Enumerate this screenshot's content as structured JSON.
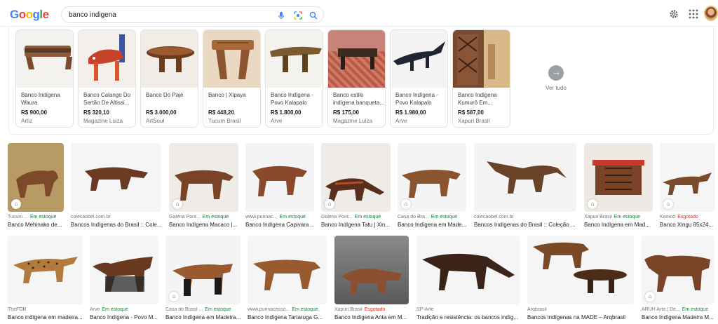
{
  "header": {
    "logo": [
      "G",
      "o",
      "o",
      "g",
      "l",
      "e"
    ],
    "logo_colors": [
      "#4285f4",
      "#ea4335",
      "#fbbc05",
      "#4285f4",
      "#34a853",
      "#ea4335"
    ],
    "search_value": "banco indigena",
    "icons": [
      "mic-icon",
      "lens-icon",
      "search-icon",
      "gear-icon",
      "apps-icon"
    ]
  },
  "shopping": {
    "cards": [
      {
        "title": "Banco Indigena Waura",
        "price": "R$ 900,00",
        "store": "Artiz"
      },
      {
        "title": "Banco Calango Do Sertão De Altissi...",
        "price": "R$ 320,10",
        "store": "Magazine Luiza"
      },
      {
        "title": "Banco Do Pajé",
        "price": "R$ 3.000,00",
        "store": "ArtSoul"
      },
      {
        "title": "Banco | Xipaya",
        "price": "R$ 448,20",
        "store": "Tucum Brasil"
      },
      {
        "title": "Banco Indígena - Povo Kalapalo",
        "price": "R$ 1.800,00",
        "store": "Arve"
      },
      {
        "title": "Banco estilo indígena banqueta...",
        "price": "R$ 175,00",
        "store": "Magazine Luiza"
      },
      {
        "title": "Banco Indígena - Povo Kalapalo",
        "price": "R$ 1.980,00",
        "store": "Arve"
      },
      {
        "title": "Banco Indigena Kumurô Em...",
        "price": "R$ 587,00",
        "store": "Xapuri Brasil"
      }
    ],
    "see_all": "Ver tudo"
  },
  "row1": [
    {
      "source": "Tucum ...",
      "status": "Em estoque",
      "caption": "Banco Mehinako de..."
    },
    {
      "source": "colecaobel.com.br",
      "status": "",
      "caption": "Bancos Indígenas do Brasil :: Cole..."
    },
    {
      "source": "Galeria Pont...",
      "status": "Em estoque",
      "caption": "Banco Indígena Macaco |..."
    },
    {
      "source": "www.purinac...",
      "status": "Em estoque",
      "caption": "Banco Indígena Capivara ..."
    },
    {
      "source": "Galeria Pont...",
      "status": "Em estoque",
      "caption": "Banco Indígena Tatu | Xin..."
    },
    {
      "source": "Casa do Bra...",
      "status": "Em estoque",
      "caption": "Banco Indígena em Made..."
    },
    {
      "source": "colecaobel.com.br",
      "status": "",
      "caption": "Bancos Indígenas do Brasil :: Coleção ..."
    },
    {
      "source": "Xapuri Brasil",
      "status": "Em estoque",
      "caption": "Banco Indígena em Mad..."
    },
    {
      "source": "Kamoo",
      "status": "Esgotado",
      "caption": "Banco Xingu 85x24..."
    }
  ],
  "row2": [
    {
      "source": "TheFOB",
      "status": "",
      "caption": "Banco indígena em madeira..."
    },
    {
      "source": "Arve",
      "status": "Em estoque",
      "caption": "Banco Indígena - Povo M..."
    },
    {
      "source": "Casa do Brasil ...",
      "status": "Em estoque",
      "caption": "Banco Indígena em Madeira..."
    },
    {
      "source": "www.purinacesso...",
      "status": "Em estoque",
      "caption": "Banco Indígena Tartaruga G..."
    },
    {
      "source": "Xapuri Brasil",
      "status": "Esgotado",
      "caption": "Banco Indígena Anta em M..."
    },
    {
      "source": "SP-Arte",
      "status": "",
      "caption": "Tradição e resistência: os bancos indíg..."
    },
    {
      "source": "Arqbrasil",
      "status": "",
      "caption": "Bancos indígenas na MADE – Arqbrasil"
    },
    {
      "source": "ARUH Arte | De...",
      "status": "Em estoque",
      "caption": "Banco Indígena Madeira M..."
    }
  ]
}
